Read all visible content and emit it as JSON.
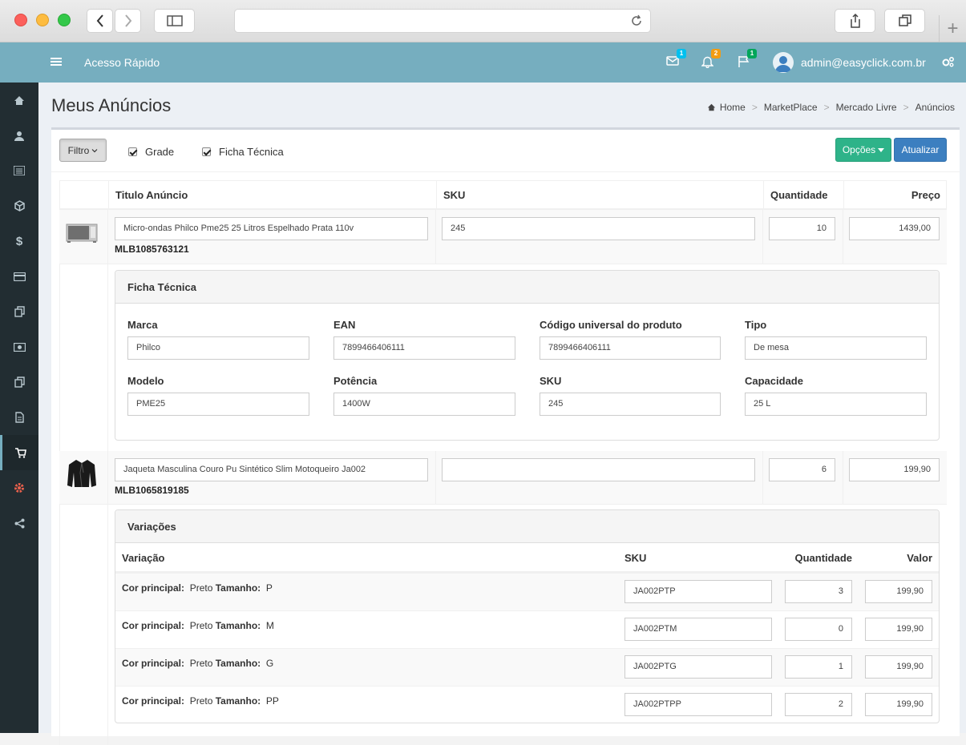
{
  "app": {
    "quick_access": "Acesso Rápido",
    "user_email": "admin@easyclick.com.br",
    "badges": {
      "messages": "1",
      "notifications": "2",
      "flags": "1"
    }
  },
  "page": {
    "title": "Meus Anúncios",
    "breadcrumb": [
      "Home",
      "MarketPlace",
      "Mercado Livre",
      "Anúncios"
    ]
  },
  "toolbar": {
    "filter_label": "Filtro",
    "grade_label": "Grade",
    "ficha_label": "Ficha Técnica",
    "options_label": "Opções",
    "refresh_label": "Atualizar"
  },
  "table": {
    "headers": {
      "title": "Titulo Anúncio",
      "sku": "SKU",
      "quantity": "Quantidade",
      "price": "Preço"
    }
  },
  "products": [
    {
      "title": "Micro-ondas Philco Pme25 25 Litros Espelhado Prata 110v",
      "mlb": "MLB1085763121",
      "sku": "245",
      "quantity": "10",
      "price": "1439,00"
    },
    {
      "title": "Jaqueta Masculina Couro Pu Sintético Slim Motoqueiro Ja002",
      "mlb": "MLB1065819185",
      "sku": "",
      "quantity": "6",
      "price": "199,90"
    }
  ],
  "ficha": {
    "title": "Ficha Técnica",
    "fields": [
      {
        "label": "Marca",
        "value": "Philco"
      },
      {
        "label": "EAN",
        "value": "7899466406111"
      },
      {
        "label": "Código universal do produto",
        "value": "7899466406111"
      },
      {
        "label": "Tipo",
        "value": "De mesa"
      },
      {
        "label": "Modelo",
        "value": "PME25"
      },
      {
        "label": "Potência",
        "value": "1400W"
      },
      {
        "label": "SKU",
        "value": "245"
      },
      {
        "label": "Capacidade",
        "value": "25 L"
      }
    ]
  },
  "variacoes": {
    "title": "Variações",
    "headers": {
      "variation": "Variação",
      "sku": "SKU",
      "quantity": "Quantidade",
      "value": "Valor"
    },
    "color_label": "Cor principal:",
    "size_label": "Tamanho:",
    "rows": [
      {
        "color": "Preto",
        "size": "P",
        "sku": "JA002PTP",
        "quantity": "3",
        "value": "199,90"
      },
      {
        "color": "Preto",
        "size": "M",
        "sku": "JA002PTM",
        "quantity": "0",
        "value": "199,90"
      },
      {
        "color": "Preto",
        "size": "G",
        "sku": "JA002PTG",
        "quantity": "1",
        "value": "199,90"
      },
      {
        "color": "Preto",
        "size": "PP",
        "sku": "JA002PTPP",
        "quantity": "2",
        "value": "199,90"
      }
    ]
  }
}
